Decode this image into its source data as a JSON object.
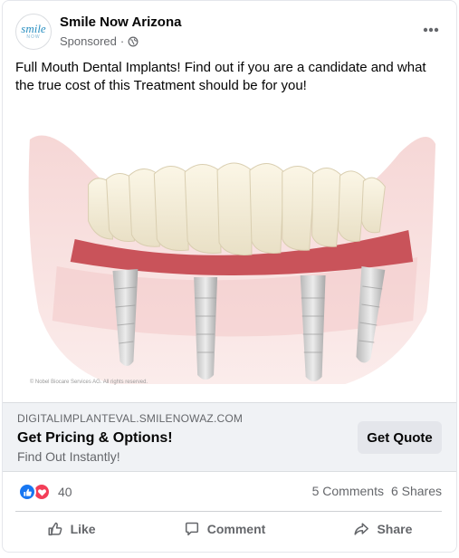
{
  "post": {
    "page_name": "Smile Now Arizona",
    "avatar_logo_text": "smile",
    "avatar_logo_sub": "NOW",
    "sponsored_label": "Sponsored",
    "separator": "·",
    "body_text": "Full Mouth Dental Implants! Find out if you are a candidate and what the true cost of this Treatment should be for you!",
    "image_caption": "© Nobel Biocare Services AG. All rights reserved."
  },
  "link": {
    "domain": "DIGITALIMPLANTEVAL.SMILENOWAZ.COM",
    "title": "Get Pricing & Options!",
    "subtitle": "Find Out Instantly!",
    "cta_label": "Get Quote"
  },
  "stats": {
    "reaction_count": "40",
    "comments": "5 Comments",
    "shares": "6 Shares"
  },
  "actions": {
    "like": "Like",
    "comment": "Comment",
    "share": "Share"
  },
  "colors": {
    "brand_blue": "#1877f2",
    "love_red": "#f33e58",
    "gum": "#c9535a",
    "secondary_text": "#65676b",
    "link_bar_bg": "#f0f2f5"
  },
  "icons": [
    "globe-icon",
    "more-options-icon",
    "like-reaction-icon",
    "love-reaction-icon",
    "like-icon",
    "comment-icon",
    "share-icon"
  ]
}
